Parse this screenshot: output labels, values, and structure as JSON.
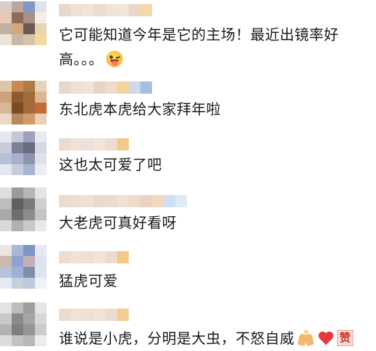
{
  "comments": [
    {
      "text": "它可能知道今年是它的主场！最近出镜率好高。。。",
      "emoji": [
        "tongue-out-face"
      ],
      "avatar_colors": [
        "#d9ccc6",
        "#b9a79e",
        "#7f97c9",
        "#dfe3ea",
        "#e8c9b2",
        "#8d6b57",
        "#a88f88",
        "#f5efe6",
        "#c2b1a3",
        "#d4a87d",
        "#6c5a52",
        "#e7d5b0",
        "#efe4d8",
        "#c9b8aa",
        "#d6c2a8",
        "#f4d99a"
      ],
      "name_colors": [
        "#ead7c9",
        "#efdfd4",
        "#f2e3d7",
        "#ecdccf",
        "#f0e3d9",
        "#f1e4d9",
        "#e9d6c8",
        "#f5d7a8"
      ]
    },
    {
      "text": "东北虎本虎给大家拜年啦",
      "emoji": [],
      "avatar_colors": [
        "#e0c6a8",
        "#c98a52",
        "#b07a45",
        "#e6d2b9",
        "#caa27e",
        "#8f5a2c",
        "#a06a3a",
        "#d9b792",
        "#d8b796",
        "#7a4c26",
        "#a46b3a",
        "#c66a3a",
        "#ead9c5",
        "#b98a5c",
        "#d39a6a",
        "#e8d1b5"
      ],
      "name_colors": [
        "#ead7c9",
        "#efdfd4",
        "#f1e3d8",
        "#e9d3c3",
        "#eedcce",
        "#f2d49d",
        "#cfd9ea",
        "#a8bde2"
      ]
    },
    {
      "text": "这也太可爱了吧",
      "emoji": [],
      "avatar_colors": [
        "#e6e6ee",
        "#c6c8d8",
        "#9aa0bd",
        "#e9eaf0",
        "#c9cbd6",
        "#7d7f96",
        "#6a6c80",
        "#d7d8e2",
        "#b7bfd9",
        "#aab0cc",
        "#8f94ad",
        "#dfe1eb",
        "#e5e7ef",
        "#c8ccdb",
        "#a9b3d3",
        "#eceef4"
      ],
      "name_colors": [
        "#ecdcd0",
        "#f0e2d8",
        "#ede0d6",
        "#f2e5db",
        "#eddccf",
        "#f4c88c"
      ]
    },
    {
      "text": "大老虎可真好看呀",
      "emoji": [],
      "avatar_colors": [
        "#dedede",
        "#9a9a9a",
        "#b5b5b5",
        "#e4e4e4",
        "#bdbdbd",
        "#5f5f5f",
        "#7a7a7a",
        "#cfcfcf",
        "#a9a9a9",
        "#6e6e6e",
        "#8c8c8c",
        "#c4c4c4",
        "#d9d9d9",
        "#b0b0b0",
        "#c8c8c8",
        "#e8e8e8"
      ],
      "name_colors": [
        "#ecdbcf",
        "#efdfd3",
        "#f0e1d6",
        "#eadacd",
        "#ecdcd0",
        "#f1e0d3",
        "#eedcca",
        "#e9d4c3",
        "#f0d9c0",
        "#cfe1f0",
        "#dfeaf5"
      ]
    },
    {
      "text": "猛虎可爱",
      "emoji": [],
      "avatar_colors": [
        "#e9e6e0",
        "#a7b7d9",
        "#7e93c6",
        "#e7e9ef",
        "#cbb9b0",
        "#8ea3cf",
        "#c2b0b6",
        "#dee4ef",
        "#b5c2dc",
        "#9fb0d6",
        "#7f8faa",
        "#dfe5ee",
        "#e7eaf0",
        "#c6cfdf",
        "#bfc9dc",
        "#eef1f5"
      ],
      "name_colors": [
        "#edddd1",
        "#f0e2d7",
        "#efe0d5",
        "#f2e4d9",
        "#ecdccf",
        "#f3c989"
      ]
    },
    {
      "text": "谁说是小虎，分明是大虫，不怒自威",
      "emoji": [
        "hands-icon",
        "red-heart-icon",
        "zan-sticker-icon"
      ],
      "zan_label": "赞",
      "avatar_colors": [
        "#e3e3e3",
        "#bcbcbc",
        "#9e9e9e",
        "#e6e6e6",
        "#c9c9c9",
        "#8a8a8a",
        "#a6a6a6",
        "#d8d8d8",
        "#b3b3b3",
        "#7f7f7f",
        "#959595",
        "#cccccc",
        "#dcdcdc",
        "#c2c2c2",
        "#b8b8b8",
        "#ececec"
      ],
      "name_colors": [
        "#ecdcd0",
        "#f0e2d8",
        "#eee0d4",
        "#f1e3d8",
        "#ecdbce",
        "#f4cc90"
      ]
    }
  ]
}
